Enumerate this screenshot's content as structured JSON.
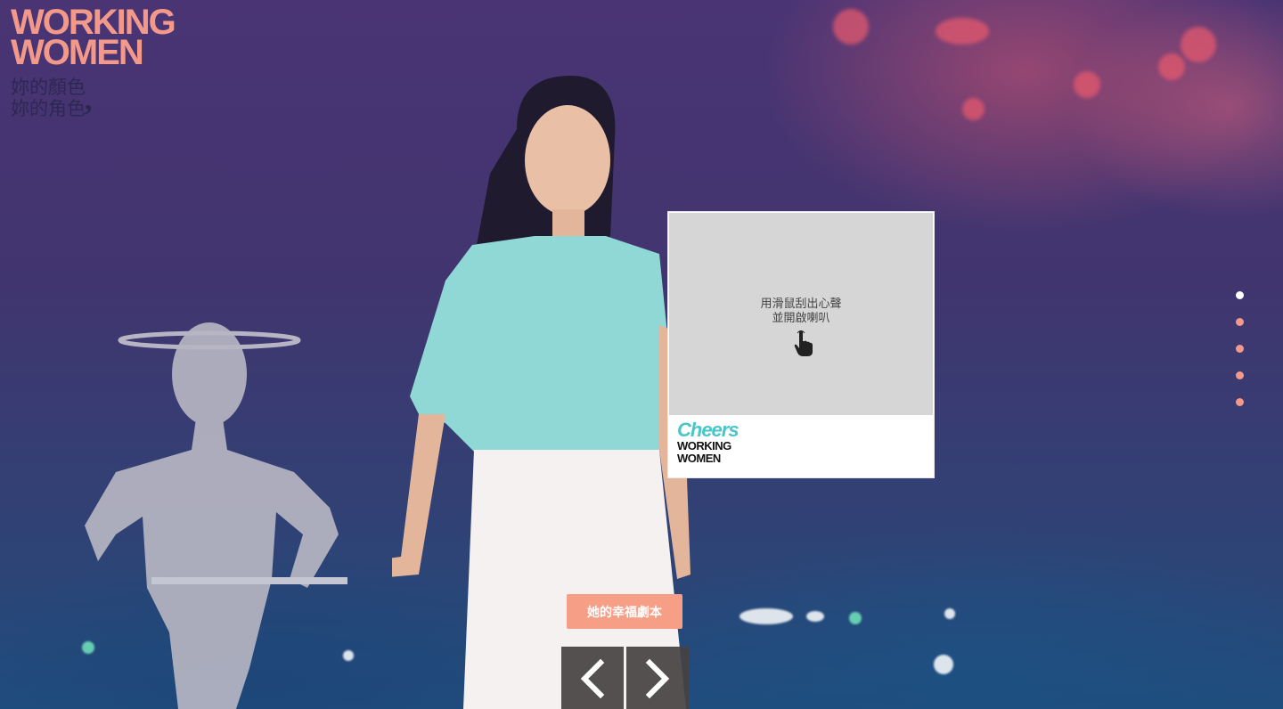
{
  "brand": {
    "line1": "WORKING",
    "line2": "WOMEN",
    "tagline_1": "妳的顏色",
    "tagline_2": "妳的角色",
    "tagline_comma": ","
  },
  "scratch_card": {
    "hint_line1": "用滑鼠刮出心聲",
    "hint_line2": "並開啟喇叭",
    "icon": "hand-pointer-icon",
    "logo_top": "Cheers",
    "logo_line1": "WORKING",
    "logo_line2": "WOMEN"
  },
  "pager": {
    "count": 5,
    "active_index": 0
  },
  "story_button": {
    "label": "她的幸福劇本"
  },
  "nav": {
    "prev_icon": "chevron-left-icon",
    "next_icon": "chevron-right-icon"
  },
  "colors": {
    "accent": "#f79e87",
    "brand": "#f2998a",
    "cheers": "#49c6c8"
  }
}
